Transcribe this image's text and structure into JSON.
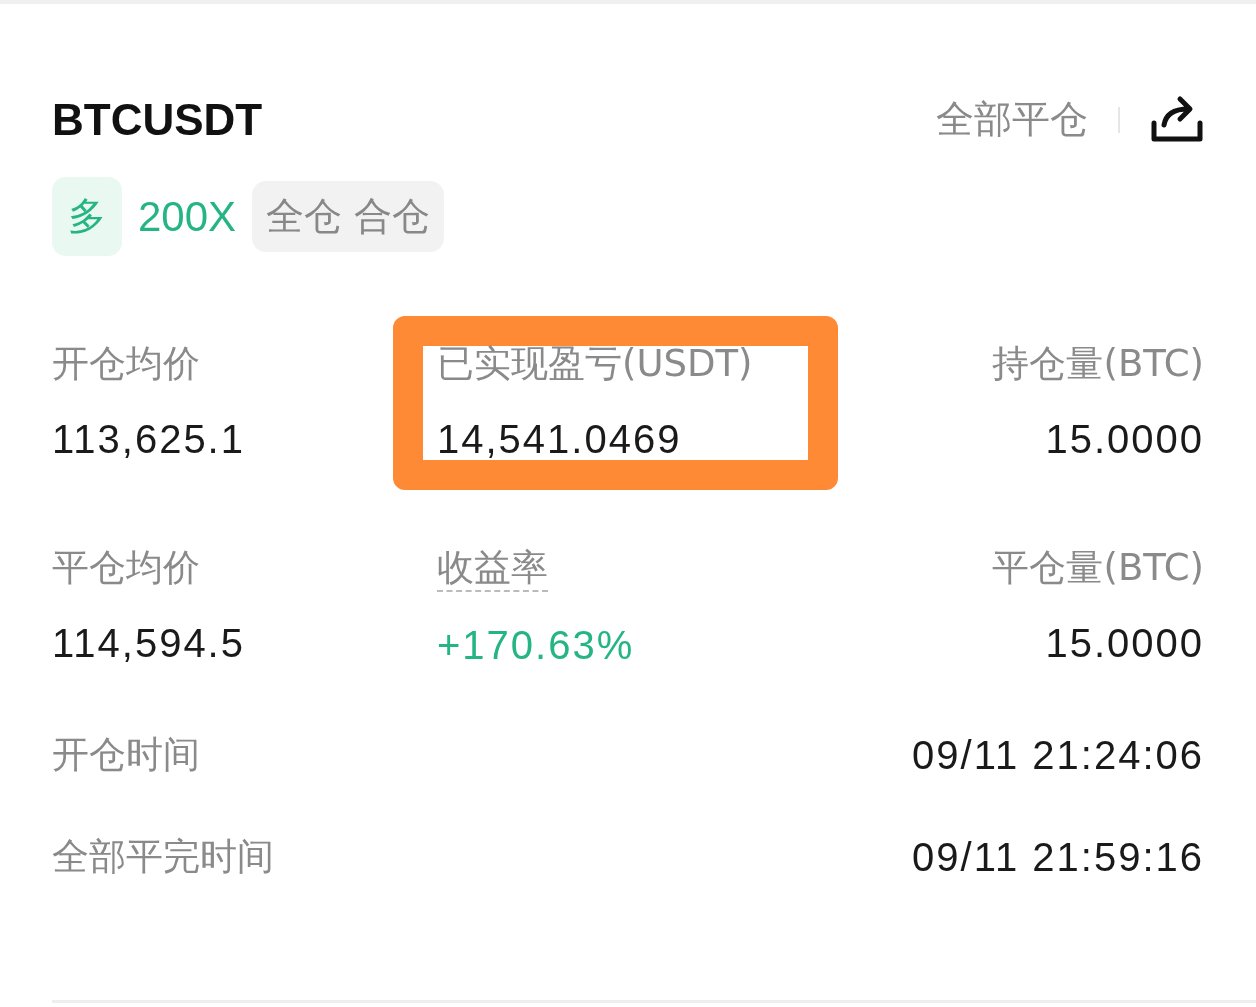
{
  "header": {
    "symbol": "BTCUSDT",
    "close_all": "全部平仓"
  },
  "tags": [
    {
      "kind": "side",
      "text": "多"
    },
    {
      "kind": "leverage",
      "text": "200X"
    },
    {
      "kind": "margin",
      "text": "全仓 合仓"
    }
  ],
  "stats": [
    {
      "label": "开仓均价",
      "value": "113,625.1",
      "kind": "plain",
      "highlighted": false,
      "hint": false
    },
    {
      "label": "已实现盈亏(USDT)",
      "value": "14,541.0469",
      "kind": "plain",
      "highlighted": true,
      "hint": false
    },
    {
      "label": "持仓量(BTC)",
      "value": "15.0000",
      "kind": "plain",
      "highlighted": false,
      "hint": false
    },
    {
      "label": "平仓均价",
      "value": "114,594.5",
      "kind": "plain",
      "highlighted": false,
      "hint": false
    },
    {
      "label": "收益率",
      "value": "+170.63%",
      "kind": "gain",
      "highlighted": false,
      "hint": true
    },
    {
      "label": "平仓量(BTC)",
      "value": "15.0000",
      "kind": "plain",
      "highlighted": false,
      "hint": false
    }
  ],
  "times": [
    {
      "label": "开仓时间",
      "value": "09/11 21:24:06"
    },
    {
      "label": "全部平完时间",
      "value": "09/11 21:59:16"
    }
  ]
}
